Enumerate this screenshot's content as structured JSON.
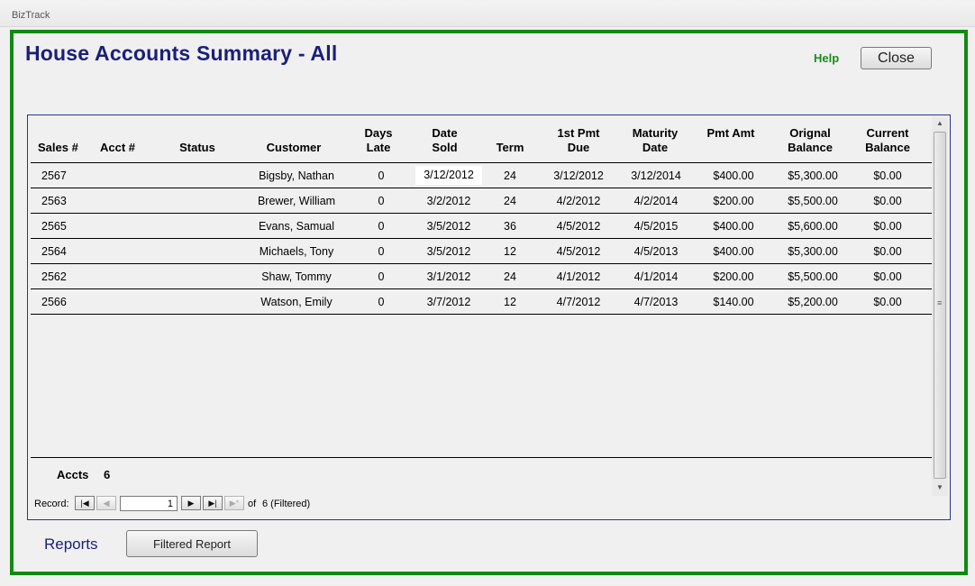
{
  "window": {
    "title": "BizTrack"
  },
  "page": {
    "title": "House Accounts Summary - All",
    "help_label": "Help",
    "close_label": "Close"
  },
  "table": {
    "headers": {
      "sales": "Sales #",
      "acct": "Acct #",
      "status": "Status",
      "customer": "Customer",
      "days_late": "Days Late",
      "date_sold": "Date Sold",
      "term": "Term",
      "first_pmt_due": "1st Pmt Due",
      "maturity_date": "Maturity Date",
      "pmt_amt": "Pmt Amt",
      "original_balance": "Orignal Balance",
      "current_balance": "Current Balance"
    },
    "rows": [
      {
        "sales": "2567",
        "acct": "",
        "status": "",
        "customer": "Bigsby, Nathan",
        "days_late": "0",
        "date_sold": "3/12/2012",
        "term": "24",
        "first_pmt_due": "3/12/2012",
        "maturity_date": "3/12/2014",
        "pmt_amt": "$400.00",
        "original_balance": "$5,300.00",
        "current_balance": "$0.00"
      },
      {
        "sales": "2563",
        "acct": "",
        "status": "",
        "customer": "Brewer, William",
        "days_late": "0",
        "date_sold": "3/2/2012",
        "term": "24",
        "first_pmt_due": "4/2/2012",
        "maturity_date": "4/2/2014",
        "pmt_amt": "$200.00",
        "original_balance": "$5,500.00",
        "current_balance": "$0.00"
      },
      {
        "sales": "2565",
        "acct": "",
        "status": "",
        "customer": "Evans, Samual",
        "days_late": "0",
        "date_sold": "3/5/2012",
        "term": "36",
        "first_pmt_due": "4/5/2012",
        "maturity_date": "4/5/2015",
        "pmt_amt": "$400.00",
        "original_balance": "$5,600.00",
        "current_balance": "$0.00"
      },
      {
        "sales": "2564",
        "acct": "",
        "status": "",
        "customer": "Michaels, Tony",
        "days_late": "0",
        "date_sold": "3/5/2012",
        "term": "12",
        "first_pmt_due": "4/5/2012",
        "maturity_date": "4/5/2013",
        "pmt_amt": "$400.00",
        "original_balance": "$5,300.00",
        "current_balance": "$0.00"
      },
      {
        "sales": "2562",
        "acct": "",
        "status": "",
        "customer": "Shaw, Tommy",
        "days_late": "0",
        "date_sold": "3/1/2012",
        "term": "24",
        "first_pmt_due": "4/1/2012",
        "maturity_date": "4/1/2014",
        "pmt_amt": "$200.00",
        "original_balance": "$5,500.00",
        "current_balance": "$0.00"
      },
      {
        "sales": "2566",
        "acct": "",
        "status": "",
        "customer": "Watson, Emily",
        "days_late": "0",
        "date_sold": "3/7/2012",
        "term": "12",
        "first_pmt_due": "4/7/2012",
        "maturity_date": "4/7/2013",
        "pmt_amt": "$140.00",
        "original_balance": "$5,200.00",
        "current_balance": "$0.00"
      }
    ]
  },
  "summary": {
    "accts_label": "Accts",
    "accts_value": "6"
  },
  "record_nav": {
    "label": "Record:",
    "current": "1",
    "of_label": "of",
    "count_text": "6 (Filtered)",
    "first_glyph": "|◀",
    "prev_glyph": "◀",
    "next_glyph": "▶",
    "last_glyph": "▶|",
    "new_glyph": "▶*"
  },
  "reports": {
    "label": "Reports",
    "filtered_report_label": "Filtered Report"
  },
  "icons": {
    "scroll_up": "▲",
    "scroll_down": "▼",
    "thumb_grip": "≡"
  },
  "colors": {
    "frame_border": "#118a11",
    "title_text": "#1a1f7a",
    "help_text": "#1b8a1b",
    "panel_border": "#2a3590"
  }
}
